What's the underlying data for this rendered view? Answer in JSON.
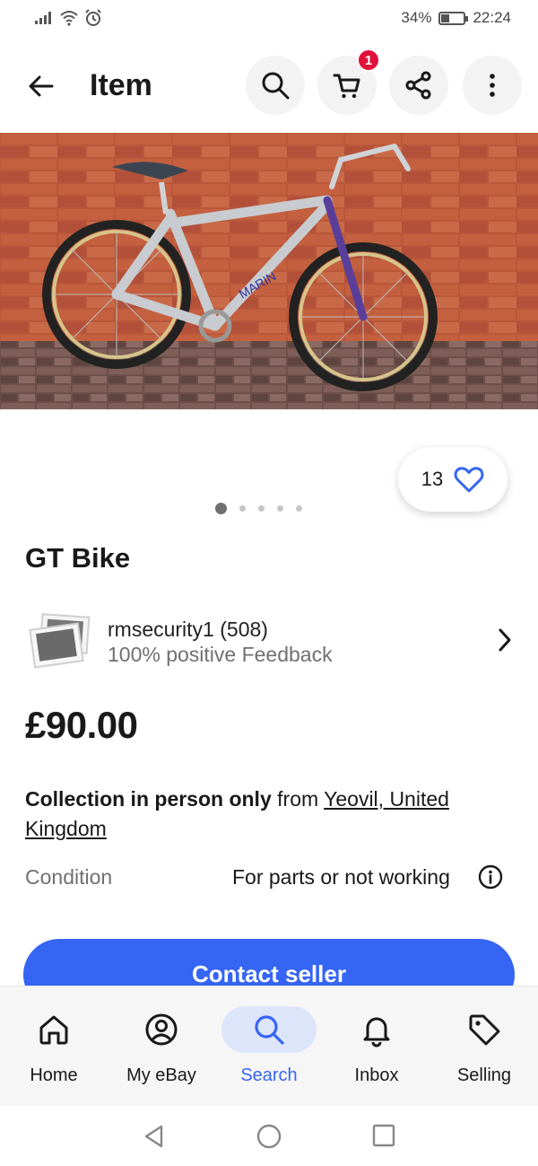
{
  "status_bar": {
    "battery_percent": "34%",
    "time": "22:24"
  },
  "header": {
    "title": "Item",
    "cart_count": "1"
  },
  "listing": {
    "watch_count": "13",
    "image_index": 1,
    "image_count": 5,
    "title": "GT Bike",
    "seller_name": "rmsecurity1 (508)",
    "seller_feedback": "100% positive Feedback",
    "price": "£90.00",
    "shipping_bold": "Collection in person only",
    "shipping_from": " from ",
    "shipping_location": "Yeovil, United Kingdom",
    "condition_label": "Condition",
    "condition_value": "For parts or not working",
    "contact_label": "Contact seller"
  },
  "bottom_nav": {
    "items": [
      {
        "label": "Home",
        "icon": "home-icon"
      },
      {
        "label": "My eBay",
        "icon": "user-icon"
      },
      {
        "label": "Search",
        "icon": "search-icon",
        "active": true
      },
      {
        "label": "Inbox",
        "icon": "bell-icon"
      },
      {
        "label": "Selling",
        "icon": "tag-icon"
      }
    ]
  },
  "colors": {
    "accent": "#3665f3",
    "badge": "#e0103a",
    "text": "#191919",
    "muted": "#707070"
  }
}
